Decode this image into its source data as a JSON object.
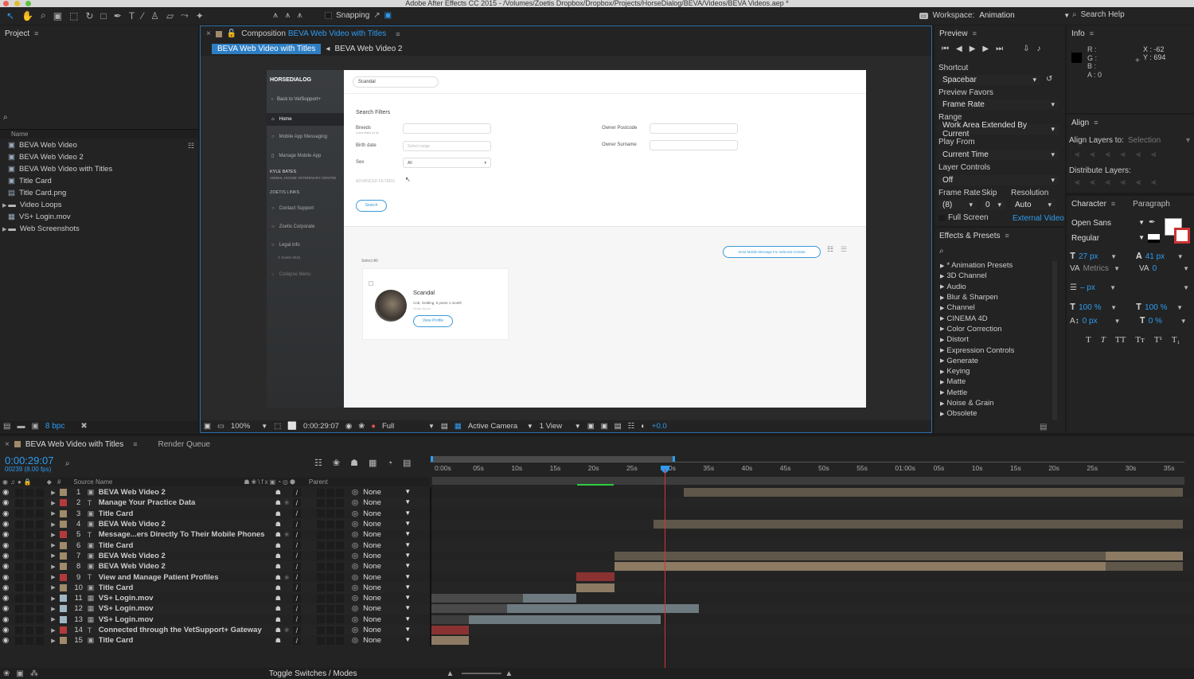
{
  "title_bar": "Adobe After Effects CC 2015 - /Volumes/Zoetis Dropbox/Dropbox/Projects/HorseDialog/BEVA/Videos/BEVA Videos.aep *",
  "toolbar": {
    "snapping": "Snapping",
    "workspace_label": "Workspace:",
    "workspace_value": "Animation",
    "search_help": "Search Help"
  },
  "project": {
    "title": "Project",
    "col_name": "Name",
    "items": [
      {
        "label": "BEVA Web Video",
        "type": "comp"
      },
      {
        "label": "BEVA Web Video 2",
        "type": "comp"
      },
      {
        "label": "BEVA Web Video with Titles",
        "type": "comp"
      },
      {
        "label": "Title Card",
        "type": "comp"
      },
      {
        "label": "Title Card.png",
        "type": "image"
      },
      {
        "label": "Video Loops",
        "type": "folder"
      },
      {
        "label": "VS+ Login.mov",
        "type": "movie"
      },
      {
        "label": "Web Screenshots",
        "type": "folder"
      }
    ],
    "bpc": "8 bpc"
  },
  "composition": {
    "label": "Composition",
    "name": "BEVA Web Video with Titles",
    "tabs": [
      "BEVA Web Video with Titles",
      "BEVA Web Video 2"
    ],
    "footer": {
      "zoom": "100%",
      "time": "0:00:29:07",
      "quality": "Full",
      "camera": "Active Camera",
      "views": "1 View",
      "exposure": "+0.0"
    }
  },
  "webapp": {
    "logo": "HORSEDIALOG",
    "search_value": "Scandal",
    "back": "Back to VetSupport+",
    "nav": [
      "Home",
      "Mobile App Messaging",
      "Manage Mobile App"
    ],
    "user_name": "KYLE BATES",
    "user_org": "ANIMAL HOUSE VETERINARY CENTRE",
    "links_hdr": "ZOETIS LINKS",
    "links": [
      "Contact Support",
      "Zoetis Corporate",
      "Legal info"
    ],
    "copyright": "© Zoetis 2016",
    "collapse": "Collapse Menu",
    "filters_title": "Search Filters",
    "breeds": "Breeds",
    "breeds_sub": "Leave blank for all",
    "birth": "Birth date",
    "birth_ph": "Select range",
    "sex": "Sex",
    "sex_value": "All",
    "postcode": "Owner Postcode",
    "surname": "Owner Surname",
    "advanced": "ADVANCED FILTERS",
    "search_btn": "Search",
    "send_btn": "Send Mobile Message For Selected Animals",
    "select_all": "Select All",
    "card_name": "Scandal",
    "card_desc": "Cob, Gelding, 6 years 1 month",
    "card_owner": "Grace Byrne",
    "card_btn": "View Profile"
  },
  "preview": {
    "title": "Preview",
    "shortcut_label": "Shortcut",
    "shortcut": "Spacebar",
    "favors_label": "Preview Favors",
    "favors": "Frame Rate",
    "range_label": "Range",
    "range": "Work Area Extended By Current",
    "play_label": "Play From",
    "play": "Current Time",
    "layer_label": "Layer Controls",
    "layer": "Off",
    "fr_label": "Frame Rate",
    "skip_label": "Skip",
    "res_label": "Resolution",
    "fr": "(8)",
    "skip": "0",
    "res": "Auto",
    "fullscreen": "Full Screen",
    "external": "External Video"
  },
  "effects": {
    "title": "Effects & Presets",
    "items": [
      "* Animation Presets",
      "3D Channel",
      "Audio",
      "Blur & Sharpen",
      "Channel",
      "CINEMA 4D",
      "Color Correction",
      "Distort",
      "Expression Controls",
      "Generate",
      "Keying",
      "Matte",
      "Mettle",
      "Noise & Grain",
      "Obsolete"
    ]
  },
  "info": {
    "title": "Info",
    "r": "R :",
    "g": "G :",
    "b": "B :",
    "a": "A : 0",
    "x": "X : -62",
    "y": "Y : 694"
  },
  "align": {
    "title": "Align",
    "align_to_label": "Align Layers to:",
    "align_to": "Selection",
    "distribute": "Distribute Layers:"
  },
  "character": {
    "title": "Character",
    "tab2": "Paragraph",
    "font": "Open Sans",
    "style": "Regular",
    "size": "27 px",
    "leading": "41 px",
    "kerning": "Metrics",
    "tracking": "0",
    "stroke": "– px",
    "vscale": "100 %",
    "hscale": "100 %",
    "baseline": "0 px",
    "tsume": "0 %",
    "styles": [
      "T",
      "T",
      "TT",
      "Tт",
      "T¹",
      "T₁"
    ]
  },
  "timeline": {
    "tab": "BEVA Web Video with Titles",
    "render_queue": "Render Queue",
    "time": "0:00:29:07",
    "frames": "00239 (8.00 fps)",
    "col_source": "Source Name",
    "col_parent": "Parent",
    "toggle": "Toggle Switches / Modes",
    "ruler": [
      "0:00s",
      "05s",
      "10s",
      "15s",
      "20s",
      "25s",
      "30s",
      "35s",
      "40s",
      "45s",
      "50s",
      "55s",
      "01:00s",
      "05s",
      "10s",
      "15s",
      "20s",
      "25s",
      "30s",
      "35s"
    ],
    "layers": [
      {
        "num": "1",
        "name": "BEVA Web Video 2",
        "type": "comp",
        "color": "#a08a6a",
        "parent": "None"
      },
      {
        "num": "2",
        "name": "Manage Your Practice Data",
        "type": "text",
        "color": "#b33a3a",
        "parent": "None"
      },
      {
        "num": "3",
        "name": "Title Card",
        "type": "comp",
        "color": "#a08a6a",
        "parent": "None"
      },
      {
        "num": "4",
        "name": "BEVA Web Video 2",
        "type": "comp",
        "color": "#a08a6a",
        "parent": "None"
      },
      {
        "num": "5",
        "name": "Message...ers Directly To Their Mobile Phones",
        "type": "text",
        "color": "#b33a3a",
        "parent": "None"
      },
      {
        "num": "6",
        "name": "Title Card",
        "type": "comp",
        "color": "#a08a6a",
        "parent": "None"
      },
      {
        "num": "7",
        "name": "BEVA Web Video 2",
        "type": "comp",
        "color": "#a08a6a",
        "parent": "None"
      },
      {
        "num": "8",
        "name": "BEVA Web Video 2",
        "type": "comp",
        "color": "#a08a6a",
        "parent": "None"
      },
      {
        "num": "9",
        "name": "View and Manage Patient Profiles",
        "type": "text",
        "color": "#b33a3a",
        "parent": "None"
      },
      {
        "num": "10",
        "name": "Title Card",
        "type": "comp",
        "color": "#a08a6a",
        "parent": "None"
      },
      {
        "num": "11",
        "name": "VS+ Login.mov",
        "type": "movie",
        "color": "#9fb7c4",
        "parent": "None"
      },
      {
        "num": "12",
        "name": "VS+ Login.mov",
        "type": "movie",
        "color": "#9fb7c4",
        "parent": "None"
      },
      {
        "num": "13",
        "name": "VS+ Login.mov",
        "type": "movie",
        "color": "#9fb7c4",
        "parent": "None"
      },
      {
        "num": "14",
        "name": "Connected through the VetSupport+ Gateway",
        "type": "text",
        "color": "#b33a3a",
        "parent": "None"
      },
      {
        "num": "15",
        "name": "Title Card",
        "type": "comp",
        "color": "#a08a6a",
        "parent": "None"
      }
    ]
  }
}
